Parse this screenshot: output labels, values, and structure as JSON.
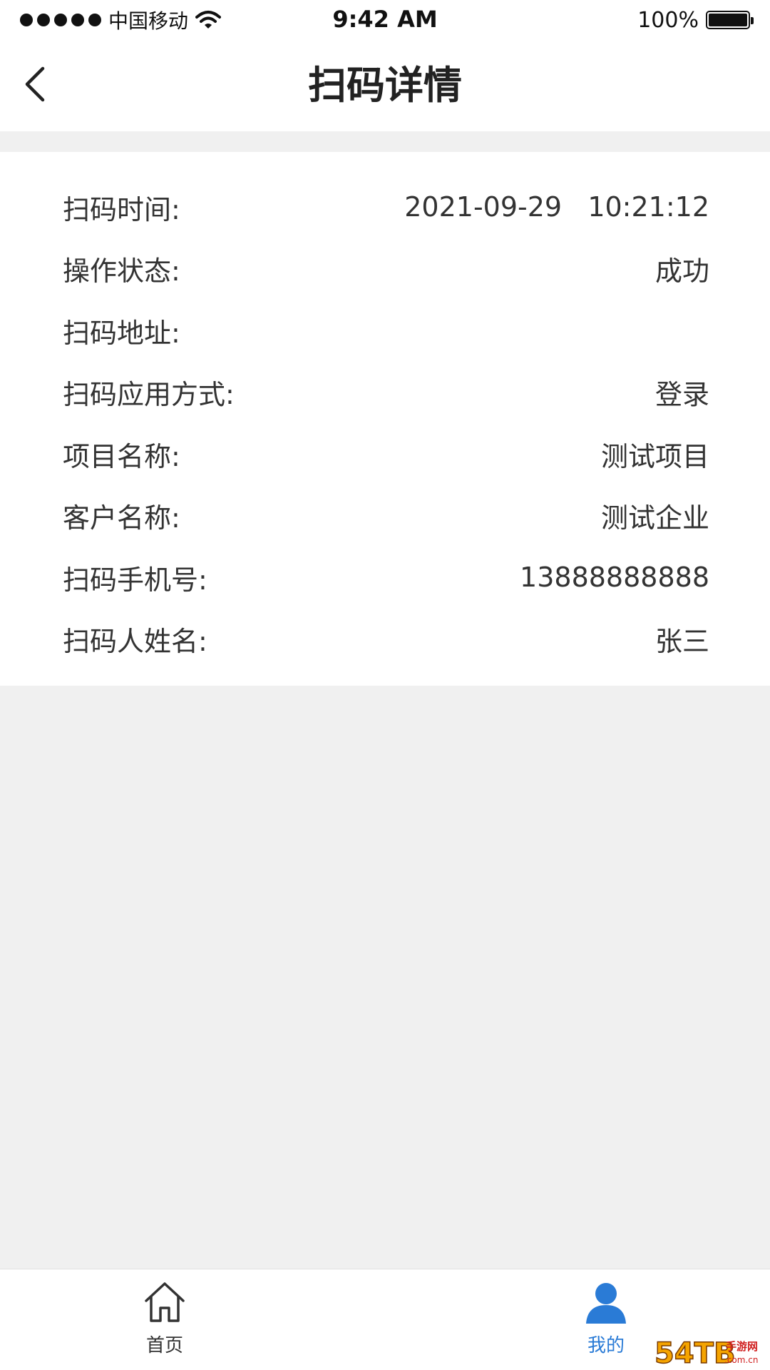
{
  "status_bar": {
    "carrier": "中国移动",
    "time": "9:42 AM",
    "battery": "100%",
    "battery_level": 1.0
  },
  "nav": {
    "title": "扫码详情",
    "back_icon": "chevron-left-icon"
  },
  "details": {
    "rows": [
      {
        "label": "扫码时间:",
        "value": "2021-09-29   10:21:12"
      },
      {
        "label": "操作状态:",
        "value": "成功"
      },
      {
        "label": "扫码地址:",
        "value": ""
      },
      {
        "label": "扫码应用方式:",
        "value": "登录"
      },
      {
        "label": "项目名称:",
        "value": "测试项目"
      },
      {
        "label": "客户名称:",
        "value": "测试企业"
      },
      {
        "label": "扫码手机号:",
        "value": "13888888888"
      },
      {
        "label": "扫码人姓名:",
        "value": "张三"
      }
    ]
  },
  "tab_bar": {
    "tabs": [
      {
        "label": "首页",
        "icon": "home-icon",
        "active": false
      },
      {
        "label": "我的",
        "icon": "user-icon",
        "active": true
      }
    ],
    "active_color": "#2a7bd6"
  },
  "watermark": {
    "text": "54TB手游网 .com.cn"
  }
}
